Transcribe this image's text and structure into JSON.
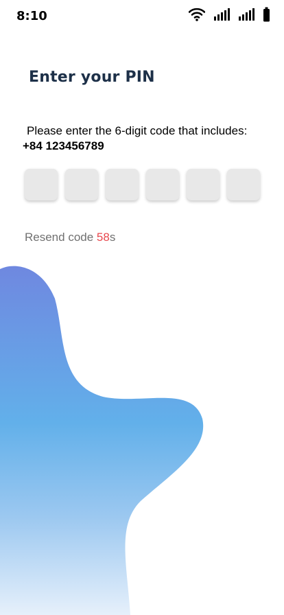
{
  "status_bar": {
    "time": "8:10",
    "icons": [
      "wifi-icon",
      "signal-icon",
      "signal-icon",
      "battery-icon"
    ]
  },
  "title": "Enter your PIN",
  "instruction": "Please enter the 6-digit code that includes:",
  "phone_number": "+84 123456789",
  "pin": {
    "length": 6,
    "values": [
      "",
      "",
      "",
      "",
      "",
      ""
    ]
  },
  "resend": {
    "label": "Resend code ",
    "seconds": "58",
    "unit": "s"
  },
  "colors": {
    "title": "#1d3048",
    "countdown": "#e8474d",
    "pin_box": "#e8e8e8",
    "blob_top": "#6f88e0",
    "blob_mid": "#62b0ea",
    "blob_bottom": "#e6f0fb"
  }
}
